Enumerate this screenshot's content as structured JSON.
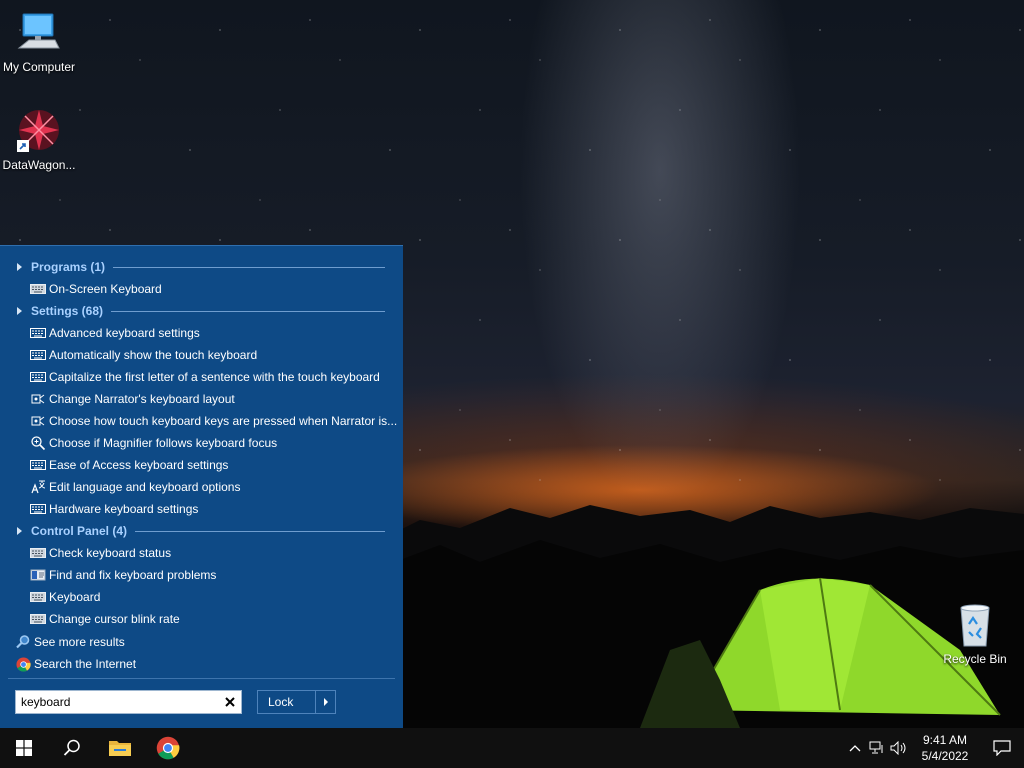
{
  "desktop": {
    "icons": [
      {
        "label": "My Computer",
        "icon": "computer-icon"
      },
      {
        "label": "DataWagon...",
        "icon": "datawagon-icon"
      },
      {
        "label": "Recycle Bin",
        "icon": "recycle-bin-icon"
      }
    ]
  },
  "search_panel": {
    "groups": [
      {
        "title": "Programs (1)",
        "items": [
          {
            "label": "On-Screen Keyboard",
            "icon": "keyboard-icon"
          }
        ]
      },
      {
        "title": "Settings (68)",
        "items": [
          {
            "label": "Advanced keyboard settings",
            "icon": "keyboard-icon"
          },
          {
            "label": "Automatically show the touch keyboard",
            "icon": "keyboard-icon"
          },
          {
            "label": "Capitalize the first letter of a sentence with the touch keyboard",
            "icon": "keyboard-icon"
          },
          {
            "label": "Change Narrator's keyboard layout",
            "icon": "narrator-icon"
          },
          {
            "label": "Choose how touch keyboard keys are pressed when Narrator is...",
            "icon": "narrator-icon"
          },
          {
            "label": "Choose if Magnifier follows keyboard focus",
            "icon": "magnifier-icon"
          },
          {
            "label": "Ease of Access keyboard settings",
            "icon": "keyboard-icon"
          },
          {
            "label": "Edit language and keyboard options",
            "icon": "language-icon"
          },
          {
            "label": "Hardware keyboard settings",
            "icon": "keyboard-icon"
          }
        ]
      },
      {
        "title": "Control Panel (4)",
        "items": [
          {
            "label": "Check keyboard status",
            "icon": "keyboard-icon"
          },
          {
            "label": "Find and fix keyboard problems",
            "icon": "troubleshoot-icon"
          },
          {
            "label": "Keyboard",
            "icon": "keyboard-icon"
          },
          {
            "label": "Change cursor blink rate",
            "icon": "keyboard-icon"
          }
        ]
      }
    ],
    "see_more": "See more results",
    "search_internet": "Search the Internet",
    "search_value": "keyboard",
    "lock_label": "Lock"
  },
  "taskbar": {
    "time": "9:41 AM",
    "date": "5/4/2022"
  }
}
